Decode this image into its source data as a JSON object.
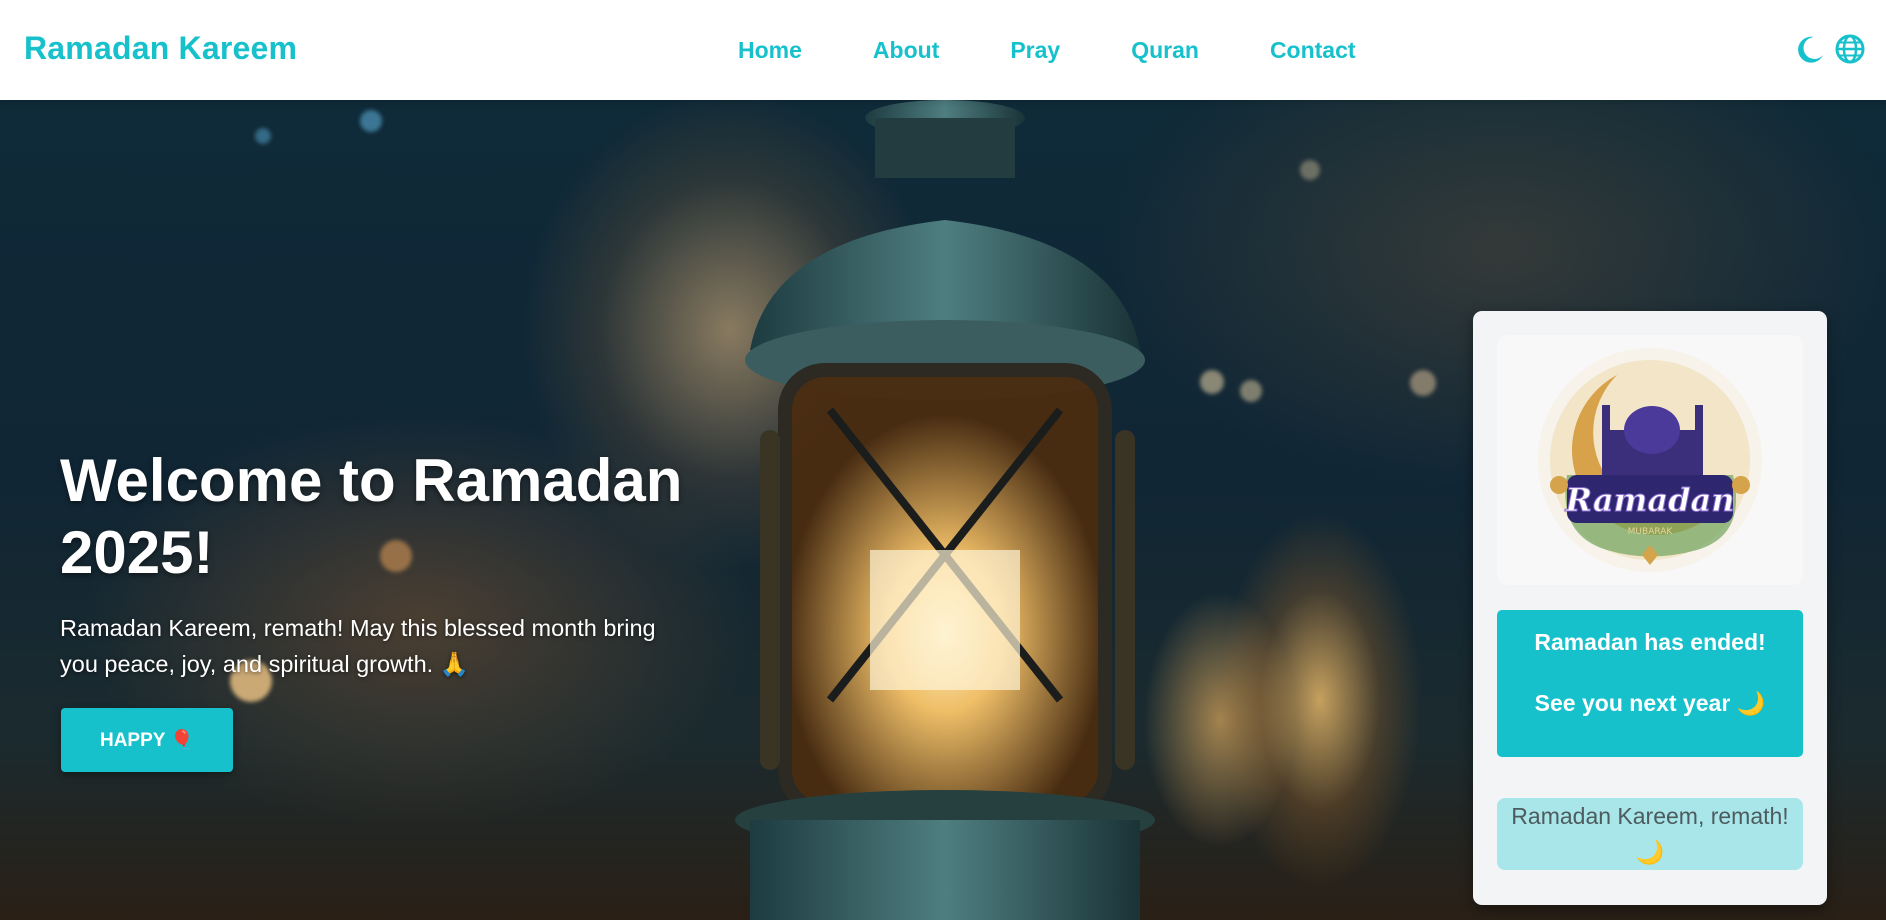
{
  "navbar": {
    "brand": "Ramadan Kareem",
    "links": [
      "Home",
      "About",
      "Pray",
      "Quran",
      "Contact"
    ],
    "icons": [
      "moon-icon",
      "globe-icon"
    ]
  },
  "hero": {
    "title": "Welcome to Ramadan 2025!",
    "subtitle": "Ramadan Kareem, remath! May this blessed month bring you peace, joy, and spiritual growth. 🙏",
    "button_label": "HAPPY 🎈"
  },
  "card": {
    "logo_text": "Ramadan",
    "logo_subtext": "MUBARAK",
    "ended_line1": "Ramadan has ended!",
    "ended_line2": "See you next year 🌙",
    "greeting": "Ramadan Kareem, remath! 🌙"
  },
  "colors": {
    "accent": "#17c1cc",
    "greeting_bg": "#a8e6ea",
    "card_bg": "#f2f4f5"
  }
}
